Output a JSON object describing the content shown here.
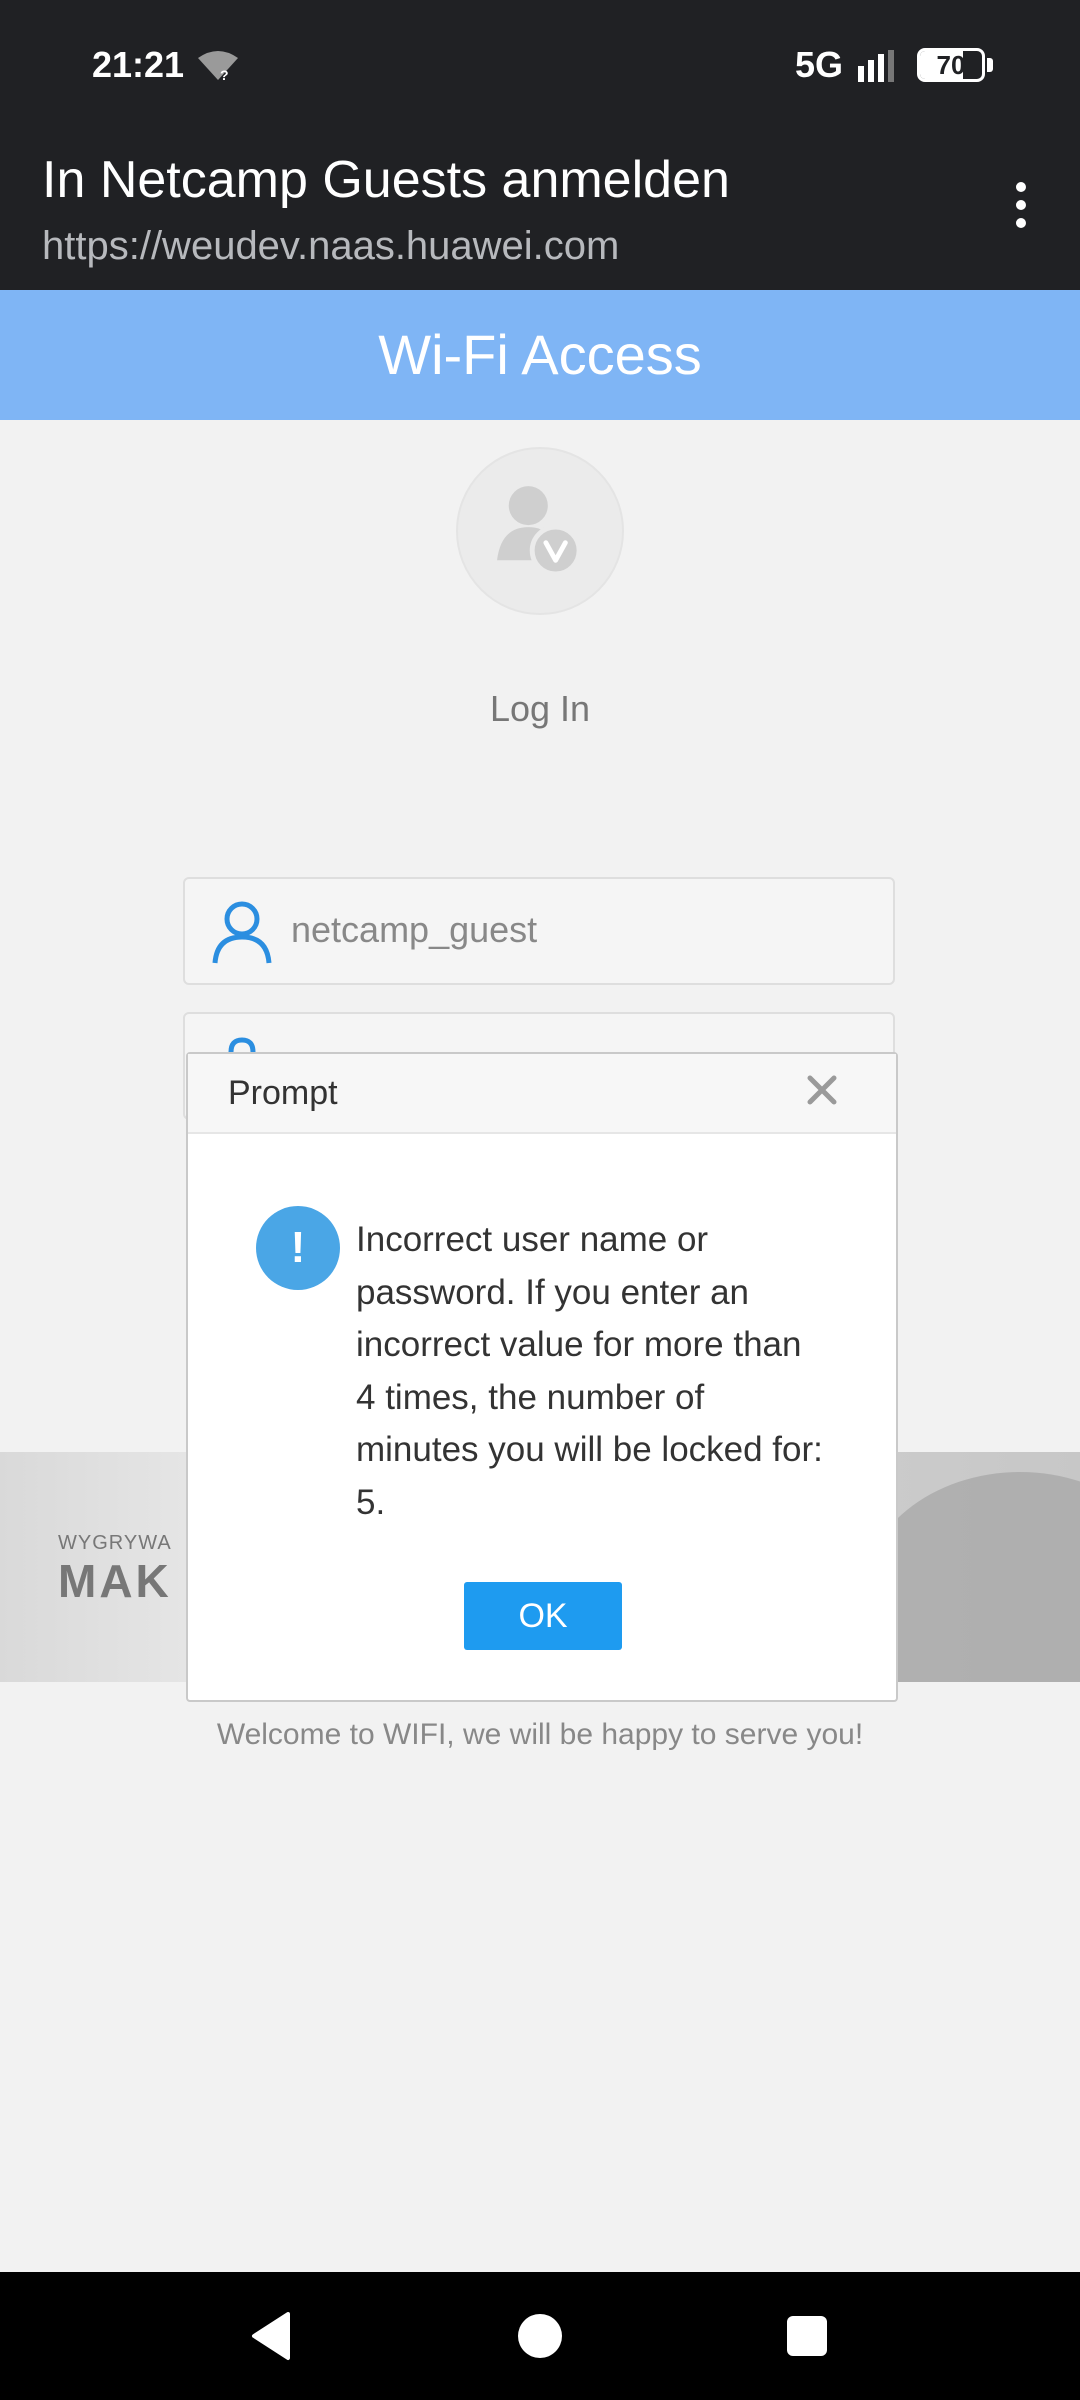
{
  "status_bar": {
    "time": "21:21",
    "network": "5G",
    "battery": "70",
    "battery_level": 0.7,
    "wifi_icon": "wifi-unknown-icon",
    "signal_icon": "signal-icon"
  },
  "browser": {
    "title": "In Netcamp Guests anmelden",
    "url": "https://weudev.naas.huawei.com",
    "menu_icon": "more-vert-icon"
  },
  "page": {
    "header": "Wi-Fi Access",
    "login_title": "Log In",
    "username": "netcamp_guest",
    "banner_text_small": "WYGRYWA",
    "banner_text_large": "MAK",
    "welcome": "Welcome to WIFI, we will be happy to serve you!"
  },
  "dialog": {
    "title": "Prompt",
    "message": "Incorrect user name or password. If you enter an incorrect value for more than 4 times, the number of minutes you will be locked for: 5.",
    "icon_symbol": "!",
    "ok_label": "OK"
  },
  "colors": {
    "header_blue": "#7fb5f5",
    "button_blue": "#1e9bf0",
    "alert_blue": "#4aa6e6",
    "dark_bar": "#202124"
  }
}
